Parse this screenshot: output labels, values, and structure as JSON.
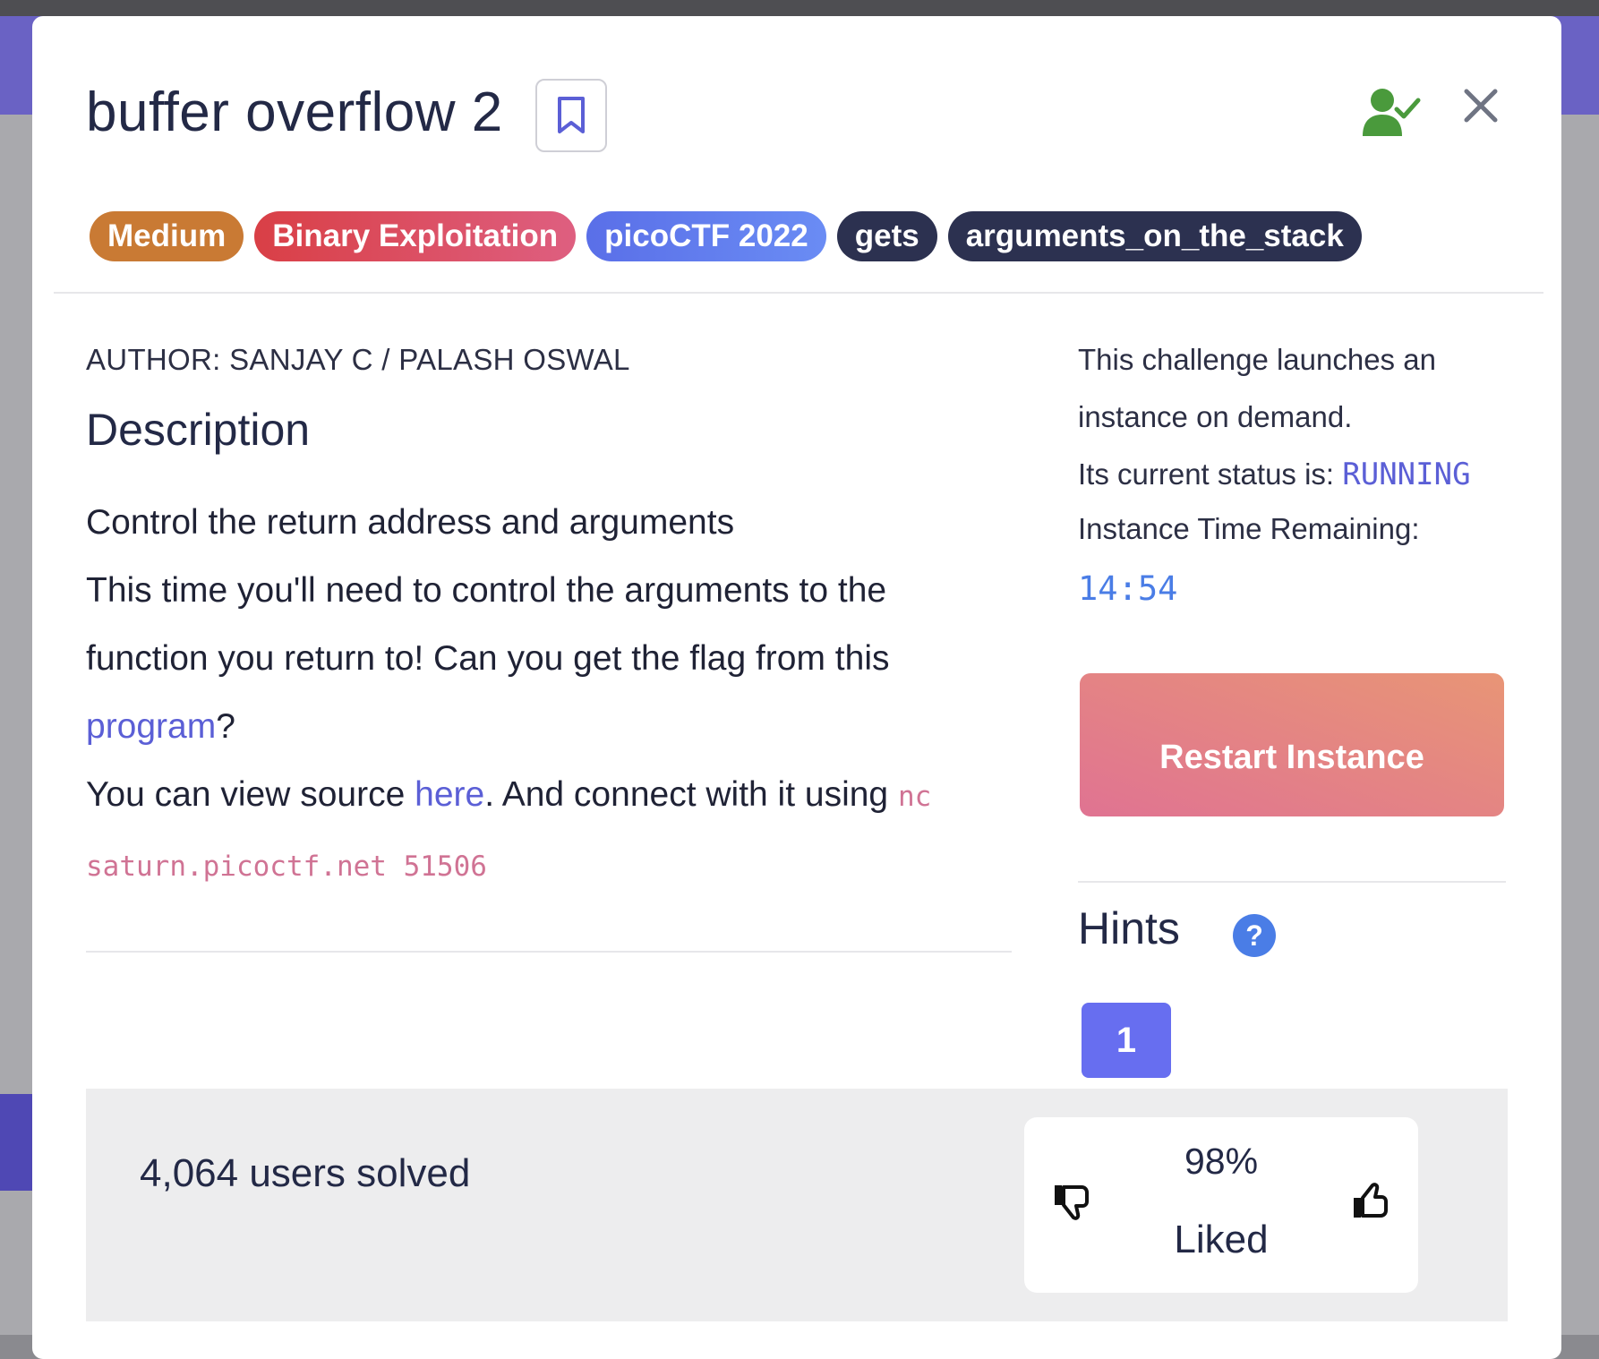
{
  "challenge": {
    "title": "buffer overflow 2",
    "tags": [
      {
        "label": "Medium",
        "kind": "difficulty",
        "color": "#c97a34"
      },
      {
        "label": "Binary Exploitation",
        "kind": "category",
        "color": "#d9434c"
      },
      {
        "label": "picoCTF 2022",
        "kind": "event",
        "color": "#5a6fe8"
      },
      {
        "label": "gets",
        "kind": "topic",
        "color": "#2c3150"
      },
      {
        "label": "arguments_on_the_stack",
        "kind": "topic",
        "color": "#2c3150"
      }
    ],
    "author": "AUTHOR: SANJAY C / PALASH OSWAL",
    "description_heading": "Description",
    "description": {
      "line1": "Control the return address and arguments",
      "line2_pre": "This time you'll need to control the arguments to the function you return to! Can you get the flag from this ",
      "program_link": "program",
      "line2_post": "?",
      "line3_pre": "You can view source ",
      "here_link": "here",
      "line3_mid": ". And connect with it using ",
      "command": "nc saturn.picoctf.net 51506"
    }
  },
  "instance": {
    "launch_text": "This challenge launches an instance on demand.",
    "status_label": "Its current status is: ",
    "status_value": "RUNNING",
    "time_label": "Instance Time Remaining:",
    "time_value": "14:54",
    "restart_label": "Restart Instance"
  },
  "hints": {
    "heading": "Hints",
    "buttons": [
      "1"
    ]
  },
  "stats": {
    "users_solved": "4,064 users solved",
    "liked_percent": "98%",
    "liked_label": "Liked"
  },
  "colors": {
    "accent": "#676ef0",
    "solved_icon": "#4a9a3c",
    "link": "#5b5fd6",
    "command": "#d07394"
  },
  "icons": {
    "bookmark": "bookmark-icon",
    "solved": "user-check-icon",
    "close": "close-icon",
    "hint_help": "question-circle-icon",
    "dislike": "thumbs-down-icon",
    "like": "thumbs-up-icon"
  }
}
